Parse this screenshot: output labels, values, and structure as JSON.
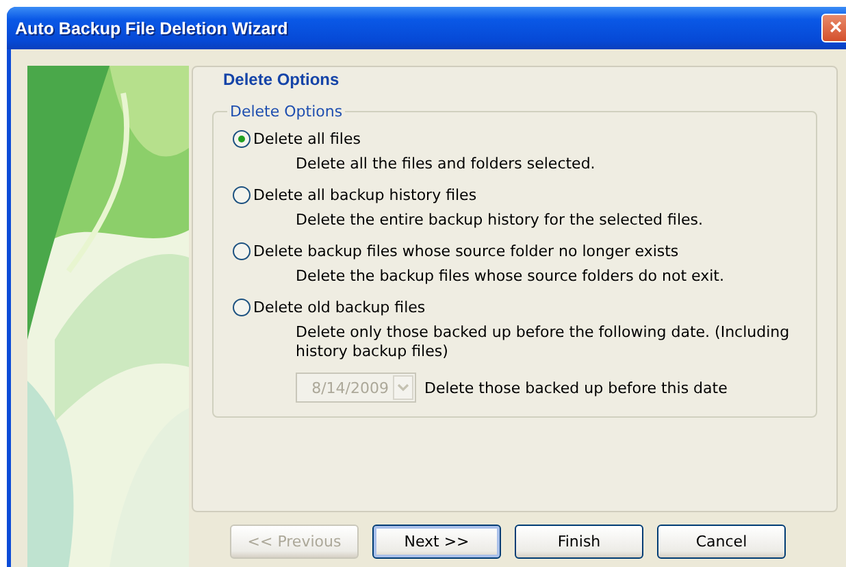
{
  "window": {
    "title": "Auto Backup File Deletion Wizard",
    "close": "×"
  },
  "page": {
    "title": "Delete Options"
  },
  "group": {
    "title": "Delete Options"
  },
  "options": [
    {
      "label": "Delete all files",
      "description": "Delete all the files and folders selected.",
      "selected": true
    },
    {
      "label": "Delete all backup history files",
      "description": "Delete the entire backup history for the selected files.",
      "selected": false
    },
    {
      "label": "Delete backup files whose source folder no longer exists",
      "description": "Delete the backup files whose source folders do not exit.",
      "selected": false
    },
    {
      "label": "Delete old backup files",
      "description": "Delete only those backed up before the following date. (Including history backup files)",
      "selected": false
    }
  ],
  "date": {
    "value": "8/14/2009",
    "disabled": true,
    "label": "Delete those backed up before this date"
  },
  "buttons": [
    {
      "label": "<< Previous",
      "disabled": true,
      "focused": false
    },
    {
      "label": "Next >>",
      "disabled": false,
      "focused": true
    },
    {
      "label": "Finish",
      "disabled": false,
      "focused": false
    },
    {
      "label": "Cancel",
      "disabled": false,
      "focused": false
    }
  ]
}
